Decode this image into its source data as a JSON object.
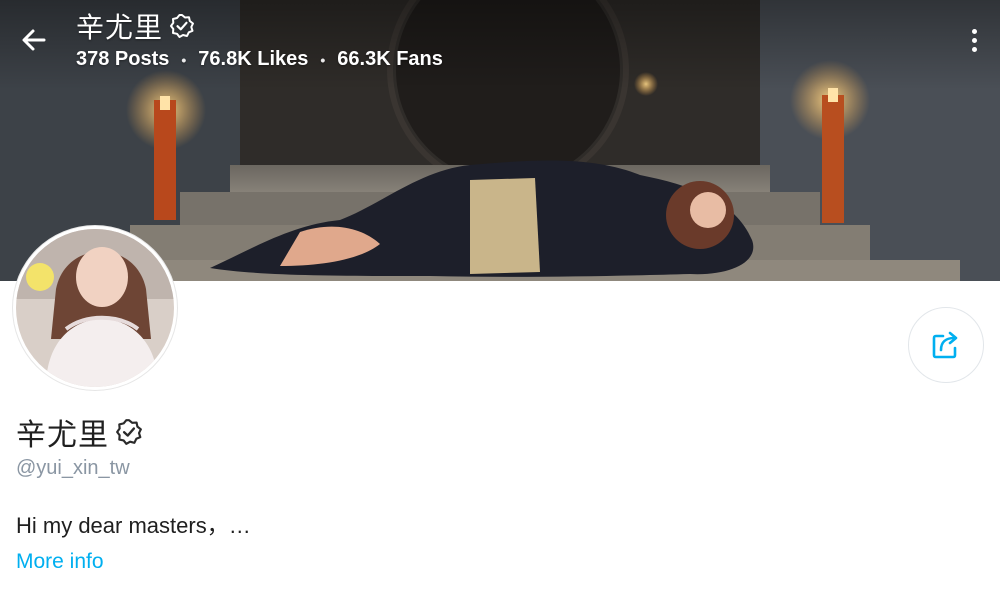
{
  "header": {
    "name": "辛尤里",
    "stats": {
      "posts": "378 Posts",
      "likes": "76.8K Likes",
      "fans": "66.3K Fans"
    }
  },
  "profile": {
    "name": "辛尤里",
    "handle": "@yui_xin_tw",
    "bio": "Hi my dear masters，…",
    "more_info": "More info"
  },
  "icons": {
    "back": "arrow-left-icon",
    "verified": "verified-badge-icon",
    "more": "more-vertical-icon",
    "share": "share-icon"
  },
  "colors": {
    "accent": "#00aff0",
    "text": "#1f1f1f",
    "muted": "#8a96a3"
  }
}
